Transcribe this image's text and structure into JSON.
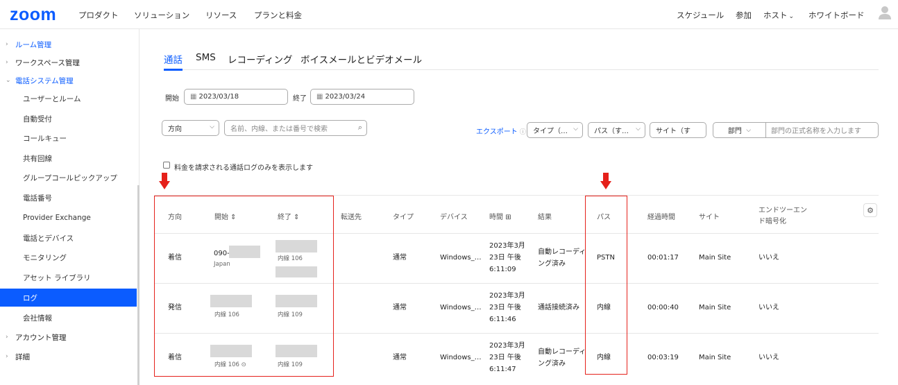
{
  "brand": {
    "logo": "zoom"
  },
  "topnav": {
    "left": [
      "プロダクト",
      "ソリューション",
      "リソース",
      "プランと料金"
    ],
    "right": [
      "スケジュール",
      "参加",
      "ホスト",
      "ホワイトボード"
    ],
    "host_chevron": "⌄"
  },
  "sidebar": {
    "items": [
      {
        "label": "ルーム管理",
        "kind": "section"
      },
      {
        "label": "ワークスペース管理",
        "kind": "section"
      },
      {
        "label": "電話システム管理",
        "kind": "section-open"
      },
      {
        "label": "ユーザーとルーム",
        "kind": "sub"
      },
      {
        "label": "自動受付",
        "kind": "sub"
      },
      {
        "label": "コールキュー",
        "kind": "sub"
      },
      {
        "label": "共有回線",
        "kind": "sub"
      },
      {
        "label": "グループコールピックアップ",
        "kind": "sub"
      },
      {
        "label": "電話番号",
        "kind": "sub"
      },
      {
        "label": "Provider Exchange",
        "kind": "sub"
      },
      {
        "label": "電話とデバイス",
        "kind": "sub"
      },
      {
        "label": "モニタリング",
        "kind": "sub"
      },
      {
        "label": "アセット ライブラリ",
        "kind": "sub"
      },
      {
        "label": "ログ",
        "kind": "active"
      },
      {
        "label": "会社情報",
        "kind": "sub"
      },
      {
        "label": "アカウント管理",
        "kind": "section"
      },
      {
        "label": "詳細",
        "kind": "section"
      }
    ]
  },
  "tabs": [
    "通話",
    "SMS",
    "レコーディング",
    "ボイスメールとビデオメール"
  ],
  "filters": {
    "start_label": "開始",
    "start_value": "2023/03/18",
    "end_label": "終了",
    "end_value": "2023/03/24",
    "direction": "方向",
    "search_placeholder": "名前、内線、または番号で検索",
    "export": "エクスポート",
    "type": "タイプ（…",
    "path": "パス（す…",
    "site": "サイト（す",
    "dept": "部門",
    "dept_placeholder": "部門の正式名称を入力します",
    "billed_only": "料金を請求される通話ログのみを表示します"
  },
  "table": {
    "headers": [
      "方向",
      "開始 ⇕",
      "終了 ⇕",
      "転送先",
      "タイプ",
      "デバイス",
      "時間",
      "結果",
      "パス",
      "経過時間",
      "サイト",
      "エンドツーエン",
      "ド暗号化"
    ],
    "rows": [
      {
        "direction": "着信",
        "start_main": "090-",
        "start_sub": "Japan",
        "end_sub": "内線 106",
        "forward": "",
        "type": "通常",
        "device": "Windows_…",
        "time1": "2023年3月",
        "time2": "23日 午後",
        "time3": "6:11:09",
        "result1": "自動レコーディ",
        "result2": "ング済み",
        "path": "PSTN",
        "elapsed": "00:01:17",
        "site": "Main Site",
        "e2ee": "いいえ"
      },
      {
        "direction": "発信",
        "start_main": "",
        "start_sub": "内線 106",
        "end_sub": "内線 109",
        "forward": "",
        "type": "通常",
        "device": "Windows_…",
        "time1": "2023年3月",
        "time2": "23日 午後",
        "time3": "6:11:46",
        "result1": "通話接続済み",
        "result2": "",
        "path": "内線",
        "elapsed": "00:00:40",
        "site": "Main Site",
        "e2ee": "いいえ"
      },
      {
        "direction": "着信",
        "start_main": "",
        "start_sub": "内線 106 ⊙",
        "end_sub": "内線 109",
        "forward": "",
        "type": "通常",
        "device": "Windows_…",
        "time1": "2023年3月",
        "time2": "23日 午後",
        "time3": "6:11:47",
        "result1": "自動レコーディ",
        "result2": "ング済み",
        "path": "内線",
        "elapsed": "00:03:19",
        "site": "Main Site",
        "e2ee": "いいえ"
      }
    ]
  },
  "colors": {
    "accent": "#0b5cff",
    "annotation": "#e5201a"
  }
}
